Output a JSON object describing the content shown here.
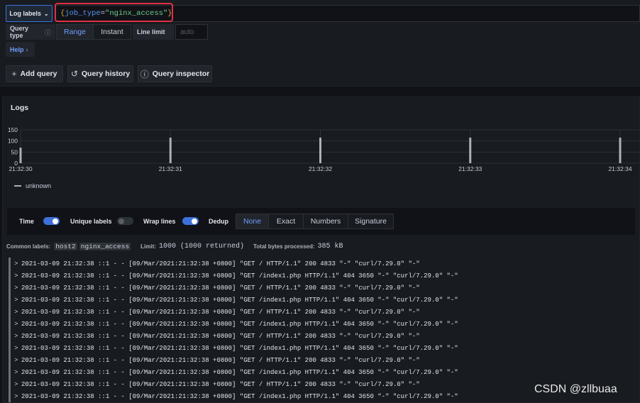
{
  "editor": {
    "log_labels_button": "Log labels",
    "query": {
      "open": "{",
      "key": "job_type",
      "op": "=",
      "value": "\"nginx_access\"",
      "close": "}"
    },
    "query_type_label": "Query type",
    "query_type_options": [
      "Range",
      "Instant"
    ],
    "query_type_selected": "Range",
    "line_limit_label": "Line limit",
    "line_limit_placeholder": "auto",
    "help_label": "Help",
    "add_query": "Add query",
    "query_history": "Query history",
    "query_inspector": "Query inspector"
  },
  "panel": {
    "title": "Logs",
    "legend": "unknown",
    "controls": {
      "time": "Time",
      "unique_labels": "Unique labels",
      "wrap_lines": "Wrap lines",
      "dedup": "Dedup",
      "time_on": true,
      "unique_labels_on": false,
      "wrap_lines_on": true,
      "dedup_options": [
        "None",
        "Exact",
        "Numbers",
        "Signature"
      ],
      "dedup_selected": "None"
    },
    "meta": {
      "common_labels_label": "Common labels:",
      "common_labels": [
        "host2",
        "nginx_access"
      ],
      "limit_label": "Limit:",
      "limit_value": "1000 (1000 returned)",
      "bytes_label": "Total bytes processed:",
      "bytes_value": "385 kB"
    },
    "log_lines": [
      "2021-03-09 21:32:38 ::1 - - [09/Mar/2021:21:32:38 +0800] \"GET / HTTP/1.1\" 200 4833 \"-\" \"curl/7.29.0\" \"-\"",
      "2021-03-09 21:32:38 ::1 - - [09/Mar/2021:21:32:38 +0800] \"GET /index1.php HTTP/1.1\" 404 3650 \"-\" \"curl/7.29.0\" \"-\"",
      "2021-03-09 21:32:38 ::1 - - [09/Mar/2021:21:32:38 +0800] \"GET / HTTP/1.1\" 200 4833 \"-\" \"curl/7.29.0\" \"-\"",
      "2021-03-09 21:32:38 ::1 - - [09/Mar/2021:21:32:38 +0800] \"GET /index1.php HTTP/1.1\" 404 3650 \"-\" \"curl/7.29.0\" \"-\"",
      "2021-03-09 21:32:38 ::1 - - [09/Mar/2021:21:32:38 +0800] \"GET / HTTP/1.1\" 200 4833 \"-\" \"curl/7.29.0\" \"-\"",
      "2021-03-09 21:32:38 ::1 - - [09/Mar/2021:21:32:38 +0800] \"GET /index1.php HTTP/1.1\" 404 3650 \"-\" \"curl/7.29.0\" \"-\"",
      "2021-03-09 21:32:38 ::1 - - [09/Mar/2021:21:32:38 +0800] \"GET / HTTP/1.1\" 200 4833 \"-\" \"curl/7.29.0\" \"-\"",
      "2021-03-09 21:32:38 ::1 - - [09/Mar/2021:21:32:38 +0800] \"GET /index1.php HTTP/1.1\" 404 3650 \"-\" \"curl/7.29.0\" \"-\"",
      "2021-03-09 21:32:38 ::1 - - [09/Mar/2021:21:32:38 +0800] \"GET / HTTP/1.1\" 200 4833 \"-\" \"curl/7.29.0\" \"-\"",
      "2021-03-09 21:32:38 ::1 - - [09/Mar/2021:21:32:38 +0800] \"GET /index1.php HTTP/1.1\" 404 3650 \"-\" \"curl/7.29.0\" \"-\"",
      "2021-03-09 21:32:38 ::1 - - [09/Mar/2021:21:32:38 +0800] \"GET / HTTP/1.1\" 200 4833 \"-\" \"curl/7.29.0\" \"-\"",
      "2021-03-09 21:32:38 ::1 - - [09/Mar/2021:21:32:38 +0800] \"GET /index1.php HTTP/1.1\" 404 3650 \"-\" \"curl/7.29.0\" \"-\""
    ]
  },
  "chart_data": {
    "type": "bar",
    "x": [
      "21:32:30",
      "21:32:31",
      "21:32:32",
      "21:32:33",
      "21:32:34"
    ],
    "series": [
      {
        "name": "unknown",
        "values": [
          70,
          115,
          115,
          115,
          115
        ]
      }
    ],
    "y_ticks": [
      0,
      50,
      100,
      150
    ],
    "ylim": [
      0,
      150
    ],
    "grid": true
  },
  "watermark": "CSDN @zllbuaa",
  "colors": {
    "accent": "#3d71d9",
    "highlight": "#e02f44",
    "bar": "#aeb1b8"
  },
  "icons": {
    "chevron": "chevron-down-icon",
    "plus": "plus-icon",
    "history": "history-icon",
    "info": "info-icon"
  }
}
